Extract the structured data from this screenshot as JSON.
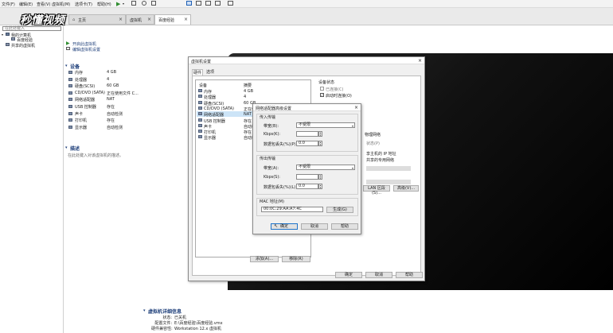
{
  "menubar": {
    "items": [
      "文件(F)",
      "编辑(E)",
      "查看(V)",
      "虚拟机(M)",
      "选项卡(T)",
      "帮助(H)"
    ]
  },
  "tabs": [
    {
      "label": "主页"
    },
    {
      "label": "虚拟机"
    },
    {
      "label": "百度经验"
    }
  ],
  "watermark": "秒懂视频",
  "library": {
    "search_placeholder": "在此处键入",
    "root": "我的计算机",
    "child": "百度经验",
    "shared": "共享的虚拟机"
  },
  "summary": {
    "actions": [
      "开启此虚拟机",
      "编辑虚拟机设置"
    ],
    "devices_header": "设备",
    "devices": [
      {
        "name": "内存",
        "value": "4 GB"
      },
      {
        "name": "处理器",
        "value": "4"
      },
      {
        "name": "硬盘(SCSI)",
        "value": "60 GB"
      },
      {
        "name": "CD/DVD (SATA)",
        "value": "正在使用文件 C..."
      },
      {
        "name": "网络适配器",
        "value": "NAT"
      },
      {
        "name": "USB 控制器",
        "value": "存在"
      },
      {
        "name": "声卡",
        "value": "自动检测"
      },
      {
        "name": "打印机",
        "value": "存在"
      },
      {
        "name": "显示器",
        "value": "自动检测"
      }
    ],
    "description_header": "描述",
    "description_text": "在此处键入对该虚拟机的描述。",
    "details_header": "虚拟机详细信息",
    "details": [
      {
        "key": "状态:",
        "value": "已关机"
      },
      {
        "key": "配置文件:",
        "value": "E:\\百度经验\\百度经验.vmx"
      },
      {
        "key": "硬件兼容性:",
        "value": "Workstation 12.x 虚拟机"
      }
    ]
  },
  "settings": {
    "title": "虚拟机设置",
    "tabs": [
      "硬件",
      "选项"
    ],
    "col_device": "设备",
    "col_summary": "摘要",
    "devices": [
      {
        "name": "内存",
        "value": "4 GB"
      },
      {
        "name": "处理器",
        "value": "4"
      },
      {
        "name": "硬盘(SCSI)",
        "value": "60 GB"
      },
      {
        "name": "CD/DVD (SATA)",
        "value": "正在使"
      },
      {
        "name": "网络适配器",
        "value": "NAT"
      },
      {
        "name": "USB 控制器",
        "value": "存在"
      },
      {
        "name": "声卡",
        "value": "自动检"
      },
      {
        "name": "打印机",
        "value": "存在"
      },
      {
        "name": "显示器",
        "value": "自动检"
      }
    ],
    "status_header": "设备状态",
    "connected": "已连接(C)",
    "connect_at_power_on": "启动时连接(O)",
    "right_partial": [
      "物理网络",
      "状态(P)",
      "享主机的 IP 地址",
      "共享的专用网络"
    ],
    "lan_button": "LAN 区段(S)...",
    "advanced_button": "高级(V)...",
    "add_button": "添加(A)...",
    "remove_button": "移除(R)",
    "ok": "确定",
    "cancel": "取消",
    "help": "帮助"
  },
  "adv": {
    "title": "网络适配器高级设置",
    "incoming": "传入传输",
    "outgoing": "传出传输",
    "bandwidth_label": "带宽(B):",
    "bandwidth_label_out": "带宽(A):",
    "bandwidth_value": "不受限",
    "kbps_label": "Kbps(K):",
    "kbps_label_out": "Kbps(S):",
    "loss_label": "数据包丢失(%)(P):",
    "loss_label_out": "数据包丢失(%)(L):",
    "loss_value": "0.0",
    "mac_label": "MAC 地址(M)",
    "mac_value": "00:0C:29:AA:A7:4C",
    "generate": "生成(G)",
    "ok": "确定",
    "cancel": "取消",
    "help": "帮助"
  }
}
